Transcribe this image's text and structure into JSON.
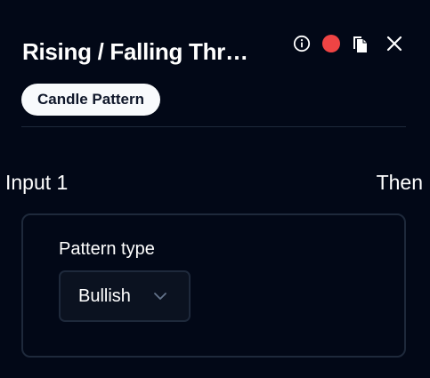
{
  "header": {
    "title": "Rising / Falling Thr…",
    "icons": {
      "info": "info-icon",
      "status": "status-dot",
      "copy": "copy-icon",
      "close": "close-icon"
    },
    "status_color": "#ef4444"
  },
  "tag": {
    "label": "Candle Pattern"
  },
  "flow": {
    "input_label": "Input 1",
    "then_label": "Then"
  },
  "pattern_field": {
    "label": "Pattern type",
    "selected": "Bullish"
  },
  "colors": {
    "background": "#020817",
    "border": "#1e293b",
    "badge_bg": "#f8fafc",
    "badge_text": "#0f172a",
    "text": "#ffffff"
  }
}
